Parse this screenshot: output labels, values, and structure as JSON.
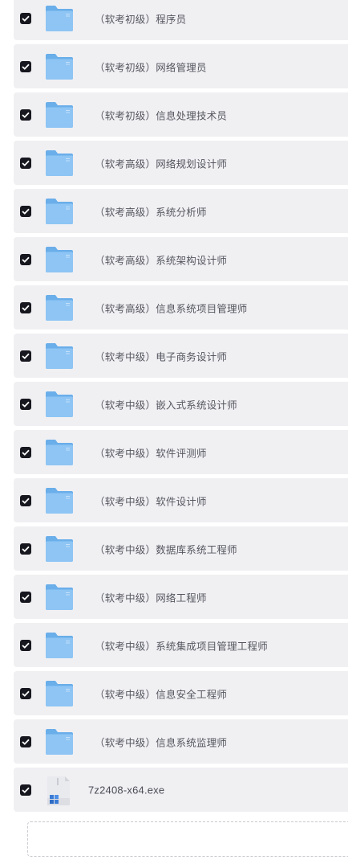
{
  "files": [
    {
      "name": "（软考初级）程序员",
      "type": "folder",
      "checked": true
    },
    {
      "name": "（软考初级）网络管理员",
      "type": "folder",
      "checked": true
    },
    {
      "name": "（软考初级）信息处理技术员",
      "type": "folder",
      "checked": true
    },
    {
      "name": "（软考高级）网络规划设计师",
      "type": "folder",
      "checked": true
    },
    {
      "name": "（软考高级）系统分析师",
      "type": "folder",
      "checked": true
    },
    {
      "name": "（软考高级）系统架构设计师",
      "type": "folder",
      "checked": true
    },
    {
      "name": "（软考高级）信息系统项目管理师",
      "type": "folder",
      "checked": true
    },
    {
      "name": "（软考中级）电子商务设计师",
      "type": "folder",
      "checked": true
    },
    {
      "name": "（软考中级）嵌入式系统设计师",
      "type": "folder",
      "checked": true
    },
    {
      "name": "（软考中级）软件评测师",
      "type": "folder",
      "checked": true
    },
    {
      "name": "（软考中级）软件设计师",
      "type": "folder",
      "checked": true
    },
    {
      "name": "（软考中级）数据库系统工程师",
      "type": "folder",
      "checked": true
    },
    {
      "name": "（软考中级）网络工程师",
      "type": "folder",
      "checked": true
    },
    {
      "name": "（软考中级）系统集成项目管理工程师",
      "type": "folder",
      "checked": true
    },
    {
      "name": "（软考中级）信息安全工程师",
      "type": "folder",
      "checked": true
    },
    {
      "name": "（软考中级）信息系统监理师",
      "type": "folder",
      "checked": true
    },
    {
      "name": "7z2408-x64.exe",
      "type": "exe",
      "checked": true
    }
  ],
  "icons": {
    "folder": "folder-icon",
    "exe": "installer-file-icon",
    "checkbox": "checkmark-icon"
  },
  "colors": {
    "row_background": "#f0f0f3",
    "checkbox_fill": "#17171f",
    "folder_front": "#8ec5f4",
    "folder_back": "#6aaeea",
    "label_text": "#55565f"
  }
}
